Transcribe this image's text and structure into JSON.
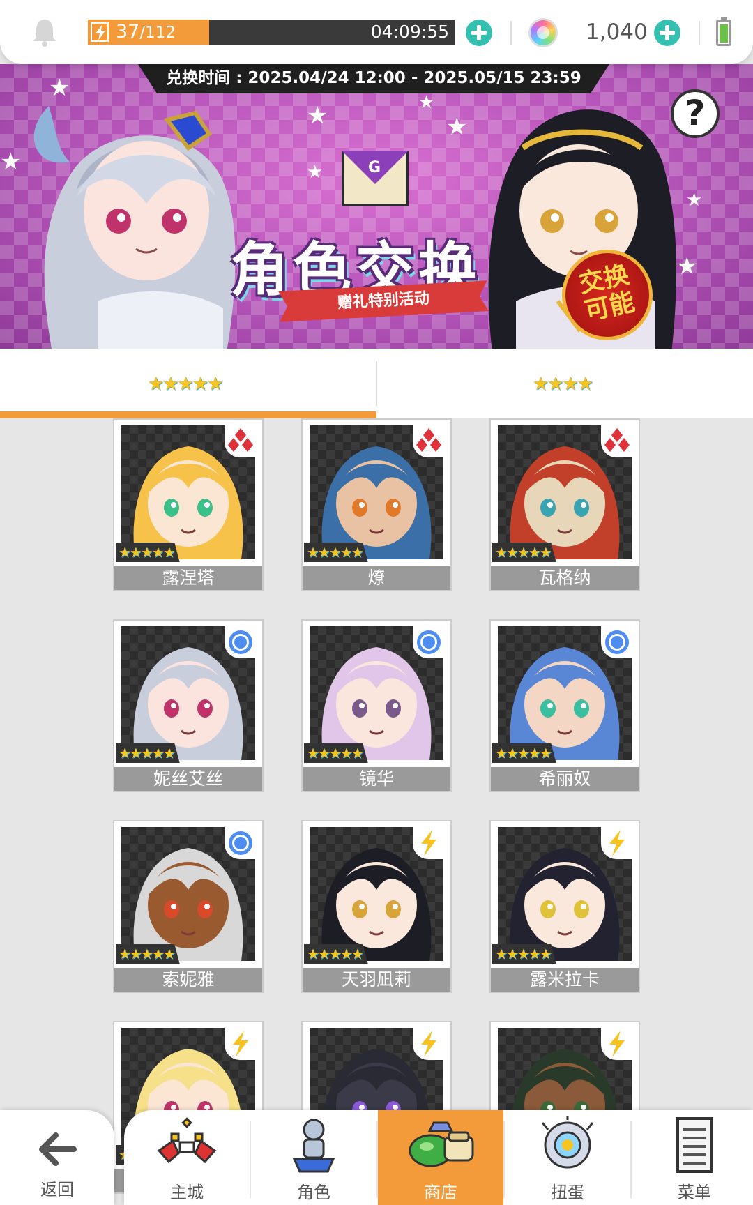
{
  "status_bar": {
    "stamina_current": "37",
    "stamina_max": "/112",
    "stamina_fraction": 0.33,
    "regen_timer": "04:09:55",
    "gem_count": "1,040"
  },
  "banner": {
    "exchange_period": "兑换时间 : 2025.04/24 12:00 - 2025.05/15 23:59",
    "title": "角色交换",
    "subtitle": "赠礼特别活动",
    "badge_line1": "交换",
    "badge_line2": "可能",
    "help_symbol": "?",
    "envelope_letter": "G"
  },
  "tabs": [
    {
      "stars": "★★★★★",
      "rarity": 5,
      "active": true
    },
    {
      "stars": "★★★★",
      "rarity": 4,
      "active": false
    }
  ],
  "characters": [
    {
      "name": "露涅塔",
      "stars": "★★★★★",
      "element": "fire-diamond-icon"
    },
    {
      "name": "燎",
      "stars": "★★★★★",
      "element": "fire-diamond-icon"
    },
    {
      "name": "瓦格纳",
      "stars": "★★★★★",
      "element": "fire-diamond-icon"
    },
    {
      "name": "妮丝艾丝",
      "stars": "★★★★★",
      "element": "water-circle-icon"
    },
    {
      "name": "镜华",
      "stars": "★★★★★",
      "element": "water-circle-icon"
    },
    {
      "name": "希丽奴",
      "stars": "★★★★★",
      "element": "water-circle-icon"
    },
    {
      "name": "索妮雅",
      "stars": "★★★★★",
      "element": "water-circle-icon"
    },
    {
      "name": "天羽凪莉",
      "stars": "★★★★★",
      "element": "thunder-bolt-icon"
    },
    {
      "name": "露米拉卡",
      "stars": "★★★★★",
      "element": "thunder-bolt-icon"
    },
    {
      "name": "",
      "stars": "★★★★★",
      "element": "thunder-bolt-icon"
    },
    {
      "name": "",
      "stars": "★★★★★",
      "element": "thunder-bolt-icon"
    },
    {
      "name": "",
      "stars": "★★★★★",
      "element": "thunder-bolt-icon"
    }
  ],
  "nav": {
    "back": "返回",
    "items": [
      {
        "label": "主城",
        "icon": "castle-icon",
        "active": false
      },
      {
        "label": "角色",
        "icon": "character-icon",
        "active": false
      },
      {
        "label": "商店",
        "icon": "shop-icon",
        "active": true
      },
      {
        "label": "扭蛋",
        "icon": "gacha-icon",
        "active": false
      },
      {
        "label": "菜单",
        "icon": "menu-icon",
        "active": false
      }
    ]
  },
  "colors": {
    "accent": "#f39b3a",
    "plus_button": "#33c0b0",
    "card_label": "#9a9a9a",
    "fire": "#e0303a",
    "water": "#4d8cf0",
    "thunder": "#f5c21f"
  }
}
